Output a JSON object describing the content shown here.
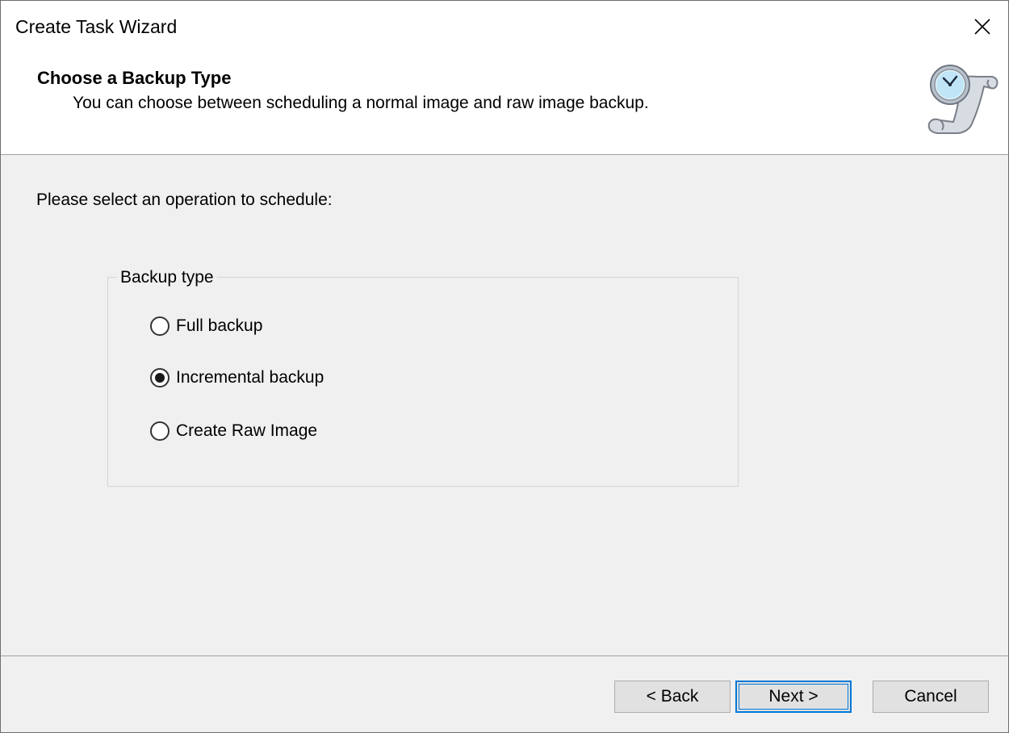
{
  "window": {
    "title": "Create Task Wizard"
  },
  "header": {
    "title": "Choose a Backup Type",
    "subtitle": "You can choose between scheduling a normal image and raw image backup.",
    "icon": "clock-scroll-icon"
  },
  "main": {
    "prompt": "Please select an operation to schedule:",
    "group_label": "Backup type",
    "options": [
      {
        "label": "Full backup",
        "selected": false
      },
      {
        "label": "Incremental backup",
        "selected": true
      },
      {
        "label": "Create Raw Image",
        "selected": false
      }
    ]
  },
  "buttons": {
    "back": "< Back",
    "next": "Next >",
    "cancel": "Cancel"
  },
  "colors": {
    "accent": "#0078d7",
    "panel": "#f0f0f0"
  }
}
